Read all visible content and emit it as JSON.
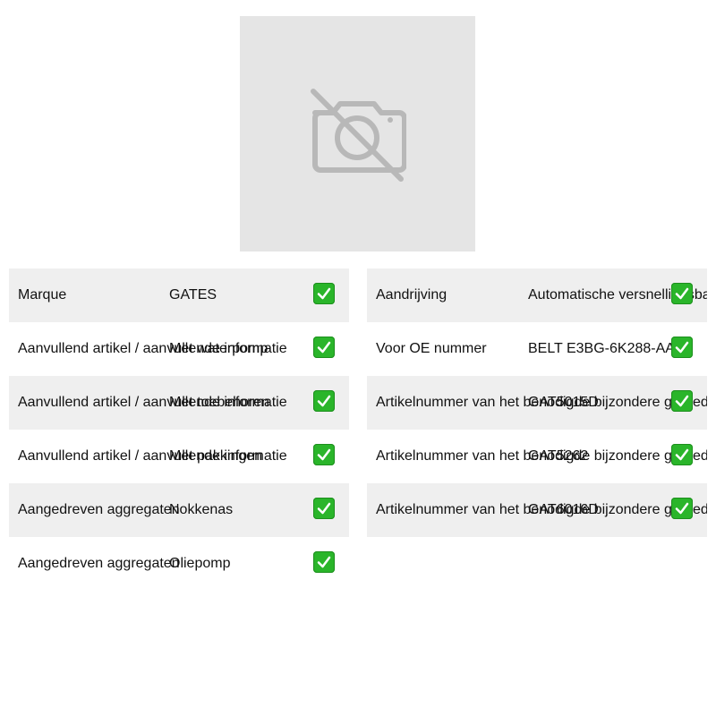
{
  "image_placeholder": {
    "icon": "no-camera-icon"
  },
  "colors": {
    "check_green": "#2ab52a",
    "row_shade": "#efefef",
    "placeholder_bg": "#e5e5e5"
  },
  "left_rows": [
    {
      "label": "Marque",
      "value": "GATES"
    },
    {
      "label": "Aanvullend artikel / aanvullende informatie",
      "value": "Met waterpomp"
    },
    {
      "label": "Aanvullend artikel / aanvullende informatie",
      "value": "Met toebehoren"
    },
    {
      "label": "Aanvullend artikel / aanvullende informatie",
      "value": "Met pakkingen"
    },
    {
      "label": "Aangedreven aggregaten",
      "value": "Nokkenas"
    },
    {
      "label": "Aangedreven aggregaten",
      "value": "Oliepomp"
    }
  ],
  "right_rows": [
    {
      "label": "Aandrijving",
      "value": "Automatische versnellingsbak"
    },
    {
      "label": "Voor OE nummer",
      "value": "BELT E3BG-6K288-AA"
    },
    {
      "label": "Artikelnummer van het benodigde bijzondere gereedschap",
      "value": "GAT5015D"
    },
    {
      "label": "Artikelnummer van het benodigde bijzondere gereedschap",
      "value": "GAT5262"
    },
    {
      "label": "Artikelnummer van het benodigde bijzondere gereedschap",
      "value": "GAT6016D"
    }
  ]
}
